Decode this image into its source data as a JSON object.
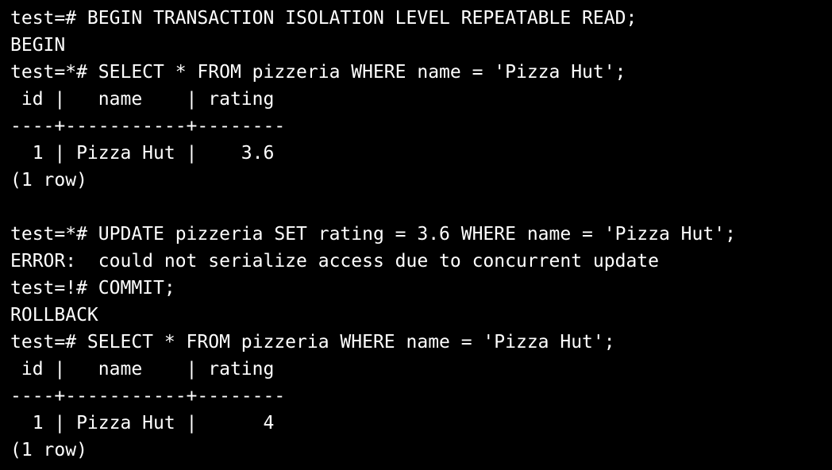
{
  "terminal": {
    "foreground": "#ffffff",
    "background": "#000000",
    "lines": [
      "test=# BEGIN TRANSACTION ISOLATION LEVEL REPEATABLE READ;",
      "BEGIN",
      "test=*# SELECT * FROM pizzeria WHERE name = 'Pizza Hut';",
      " id |   name    | rating",
      "----+-----------+--------",
      "  1 | Pizza Hut |    3.6",
      "(1 row)",
      "",
      "test=*# UPDATE pizzeria SET rating = 3.6 WHERE name = 'Pizza Hut';",
      "ERROR:  could not serialize access due to concurrent update",
      "test=!# COMMIT;",
      "ROLLBACK",
      "test=# SELECT * FROM pizzeria WHERE name = 'Pizza Hut';",
      " id |   name    | rating",
      "----+-----------+--------",
      "  1 | Pizza Hut |      4",
      "(1 row)"
    ]
  }
}
